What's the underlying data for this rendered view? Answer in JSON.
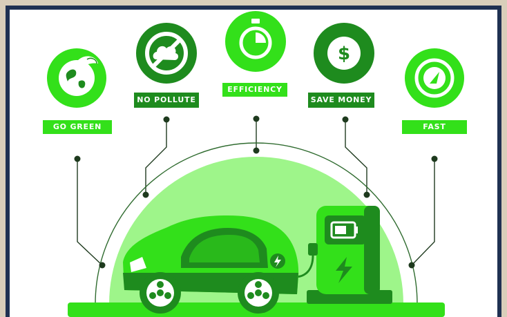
{
  "features": [
    {
      "id": "go-green",
      "label": "GO GREEN",
      "icon": "leaf-globe-icon"
    },
    {
      "id": "no-pollute",
      "label": "NO POLLUTE",
      "icon": "no-pollution-icon"
    },
    {
      "id": "efficiency",
      "label": "EFFICIENCY",
      "icon": "stopwatch-icon"
    },
    {
      "id": "save-money",
      "label": "SAVE MONEY",
      "icon": "dollar-coin-icon"
    },
    {
      "id": "fast",
      "label": "FAST",
      "icon": "speedometer-icon"
    }
  ],
  "colors": {
    "bright_green": "#33e01a",
    "dark_green": "#1e8b1e",
    "light_green": "#9ef58a",
    "line": "#1e3a1e",
    "frame": "#1f3152",
    "outer_border": "#d9ceba"
  },
  "scene": {
    "car_icon": "electric-car-icon",
    "charger_icon": "charging-station-icon",
    "battery_icon": "battery-icon",
    "bolt_icon": "lightning-bolt-icon"
  }
}
